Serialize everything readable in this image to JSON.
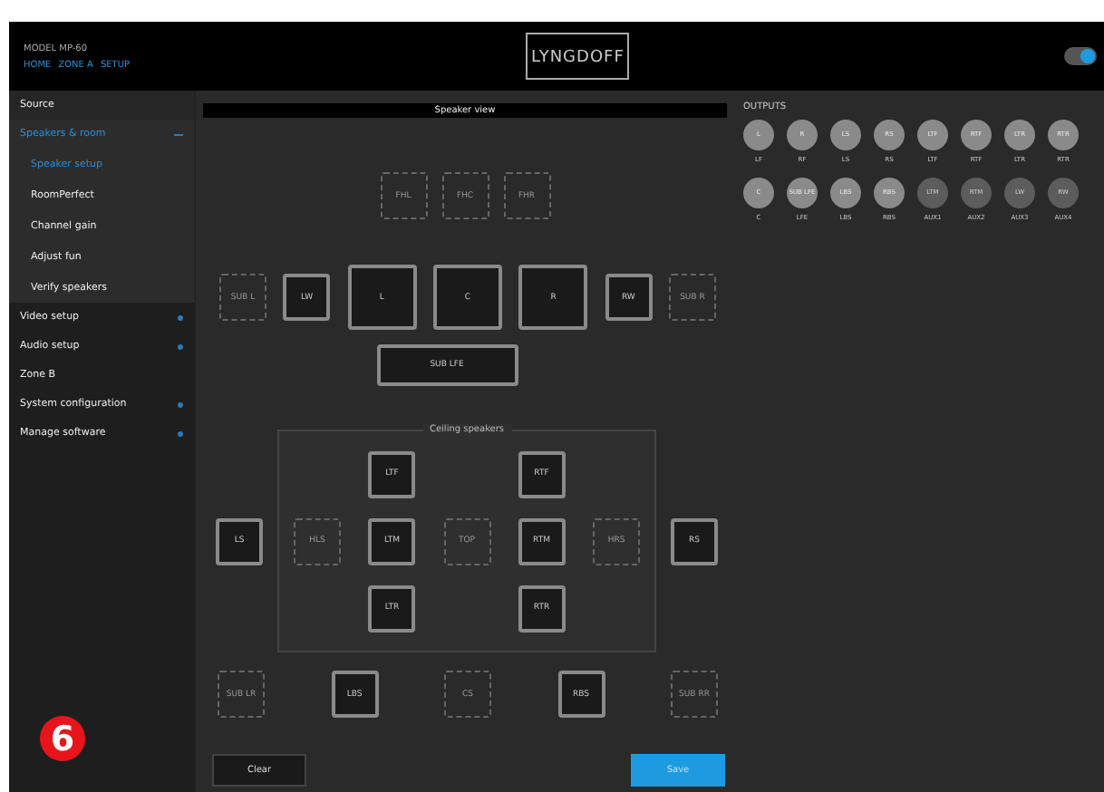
{
  "header": {
    "model": "MODEL MP-60",
    "breadcrumb": [
      "HOME",
      "ZONE A",
      "SETUP"
    ],
    "logo": "LYNGDOFF",
    "toggle": {
      "on": true
    }
  },
  "sidebar": {
    "items": [
      {
        "label": "Source",
        "expanded": false,
        "has_children": false
      },
      {
        "label": "Speakers & room",
        "expanded": true,
        "has_children": true,
        "children": [
          {
            "label": "Speaker setup",
            "selected": true
          },
          {
            "label": "RoomPerfect",
            "selected": false
          },
          {
            "label": "Channel gain",
            "selected": false
          },
          {
            "label": "Adjust fun",
            "selected": false
          },
          {
            "label": "Verify speakers",
            "selected": false
          }
        ]
      },
      {
        "label": "Video setup",
        "expanded": false,
        "has_children": true
      },
      {
        "label": "Audio setup",
        "expanded": false,
        "has_children": true
      },
      {
        "label": "Zone B",
        "expanded": false,
        "has_children": false
      },
      {
        "label": "System configuration",
        "expanded": false,
        "has_children": true
      },
      {
        "label": "Manage software",
        "expanded": false,
        "has_children": true
      }
    ],
    "callout": "6"
  },
  "speaker_view": {
    "title": "Speaker view",
    "front_heights": [
      {
        "label": "FHL",
        "active": false
      },
      {
        "label": "FHC",
        "active": false
      },
      {
        "label": "FHR",
        "active": false
      }
    ],
    "front": [
      {
        "label": "SUB L",
        "active": false,
        "kind": "small"
      },
      {
        "label": "LW",
        "active": true,
        "kind": "small"
      },
      {
        "label": "L",
        "active": true,
        "kind": "large"
      },
      {
        "label": "C",
        "active": true,
        "kind": "large"
      },
      {
        "label": "R",
        "active": true,
        "kind": "large"
      },
      {
        "label": "RW",
        "active": true,
        "kind": "small"
      },
      {
        "label": "SUB R",
        "active": false,
        "kind": "small"
      }
    ],
    "lfe": {
      "label": "SUB LFE",
      "active": true
    },
    "side_left": {
      "label": "LS",
      "active": true
    },
    "side_right": {
      "label": "RS",
      "active": true
    },
    "ceiling": {
      "title": "Ceiling speakers",
      "left_outer": {
        "label": "HLS",
        "active": false
      },
      "left": [
        {
          "label": "LTF",
          "active": true
        },
        {
          "label": "LTM",
          "active": true
        },
        {
          "label": "LTR",
          "active": true
        }
      ],
      "center": {
        "label": "TOP",
        "active": false
      },
      "right": [
        {
          "label": "RTF",
          "active": true
        },
        {
          "label": "RTM",
          "active": true
        },
        {
          "label": "RTR",
          "active": true
        }
      ],
      "right_outer": {
        "label": "HRS",
        "active": false
      }
    },
    "rear": [
      {
        "label": "SUB LR",
        "active": false
      },
      {
        "label": "LBS",
        "active": true
      },
      {
        "label": "CS",
        "active": false
      },
      {
        "label": "RBS",
        "active": true
      },
      {
        "label": "SUB RR",
        "active": false
      }
    ],
    "buttons": [
      {
        "label": "Clear",
        "kind": "secondary"
      },
      {
        "label": "Save",
        "kind": "primary"
      }
    ]
  },
  "outputs": {
    "title": "OUTPUTS",
    "rows": [
      [
        {
          "channel": "L",
          "output": "LF",
          "assigned": true
        },
        {
          "channel": "R",
          "output": "RF",
          "assigned": true
        },
        {
          "channel": "LS",
          "output": "LS",
          "assigned": true
        },
        {
          "channel": "RS",
          "output": "RS",
          "assigned": true
        },
        {
          "channel": "LTF",
          "output": "LTF",
          "assigned": true
        },
        {
          "channel": "RTF",
          "output": "RTF",
          "assigned": true
        },
        {
          "channel": "LTR",
          "output": "LTR",
          "assigned": true
        },
        {
          "channel": "RTR",
          "output": "RTR",
          "assigned": true
        }
      ],
      [
        {
          "channel": "C",
          "output": "C",
          "assigned": true
        },
        {
          "channel": "SUB LFE",
          "output": "LFE",
          "assigned": true
        },
        {
          "channel": "LBS",
          "output": "LBS",
          "assigned": true
        },
        {
          "channel": "RBS",
          "output": "RBS",
          "assigned": true
        },
        {
          "channel": "LTM",
          "output": "AUX1",
          "assigned": false
        },
        {
          "channel": "RTM",
          "output": "AUX2",
          "assigned": false
        },
        {
          "channel": "LW",
          "output": "AUX3",
          "assigned": false
        },
        {
          "channel": "RW",
          "output": "AUX4",
          "assigned": false
        }
      ]
    ]
  }
}
